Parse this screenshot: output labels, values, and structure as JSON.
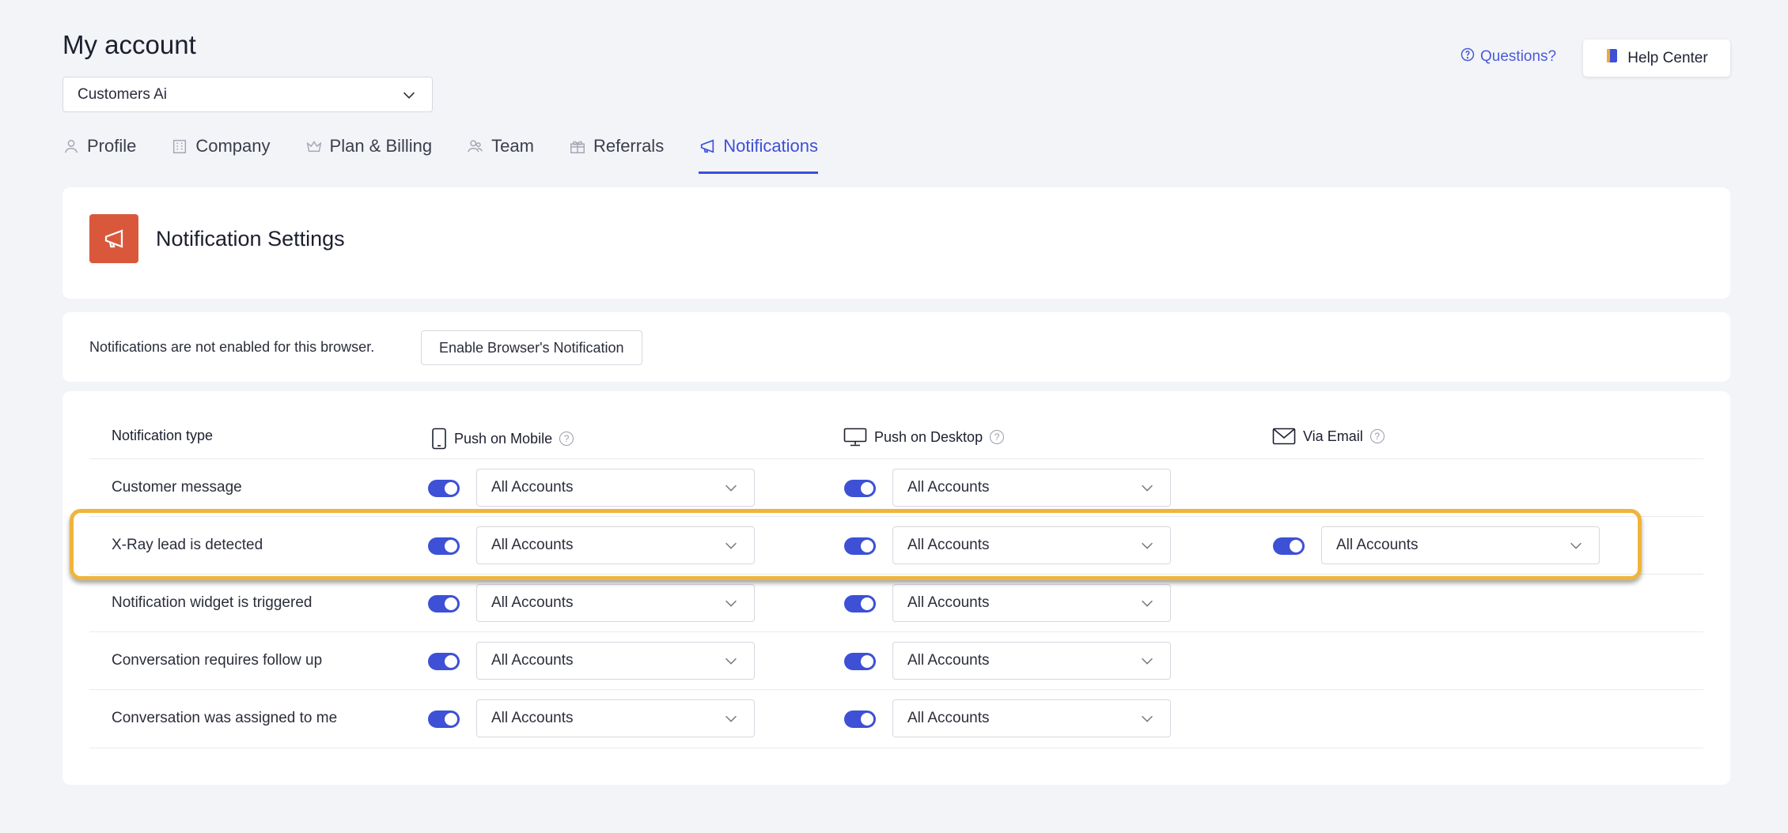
{
  "page": {
    "title": "My account"
  },
  "account_selector": {
    "value": "Customers Ai"
  },
  "header_links": {
    "questions": "Questions?",
    "help_center": "Help Center"
  },
  "tabs": [
    {
      "label": "Profile",
      "icon": "user-icon",
      "active": false
    },
    {
      "label": "Company",
      "icon": "building-icon",
      "active": false
    },
    {
      "label": "Plan & Billing",
      "icon": "crown-icon",
      "active": false
    },
    {
      "label": "Team",
      "icon": "team-icon",
      "active": false
    },
    {
      "label": "Referrals",
      "icon": "gift-icon",
      "active": false
    },
    {
      "label": "Notifications",
      "icon": "megaphone-icon",
      "active": true
    }
  ],
  "notification_settings": {
    "title": "Notification Settings",
    "icon": "megaphone-icon",
    "icon_color": "#d9583c"
  },
  "browser_notice": {
    "text": "Notifications are not enabled for this browser.",
    "button": "Enable Browser's Notification"
  },
  "table": {
    "columns": {
      "type": "Notification type",
      "mobile": "Push on Mobile",
      "desktop": "Push on Desktop",
      "email": "Via Email"
    },
    "rows": [
      {
        "label": "Customer message",
        "mobile": {
          "on": true,
          "value": "All Accounts"
        },
        "desktop": {
          "on": true,
          "value": "All Accounts"
        },
        "email": null
      },
      {
        "label": "X-Ray lead is detected",
        "mobile": {
          "on": true,
          "value": "All Accounts"
        },
        "desktop": {
          "on": true,
          "value": "All Accounts"
        },
        "email": {
          "on": true,
          "value": "All Accounts"
        },
        "highlighted": true
      },
      {
        "label": "Notification widget is triggered",
        "mobile": {
          "on": true,
          "value": "All Accounts"
        },
        "desktop": {
          "on": true,
          "value": "All Accounts"
        },
        "email": null
      },
      {
        "label": "Conversation requires follow up",
        "mobile": {
          "on": true,
          "value": "All Accounts"
        },
        "desktop": {
          "on": true,
          "value": "All Accounts"
        },
        "email": null
      },
      {
        "label": "Conversation was assigned to me",
        "mobile": {
          "on": true,
          "value": "All Accounts"
        },
        "desktop": {
          "on": true,
          "value": "All Accounts"
        },
        "email": null
      }
    ]
  },
  "colors": {
    "accent": "#3d50d6",
    "highlight": "#efb53a",
    "background": "#f3f4f8"
  }
}
